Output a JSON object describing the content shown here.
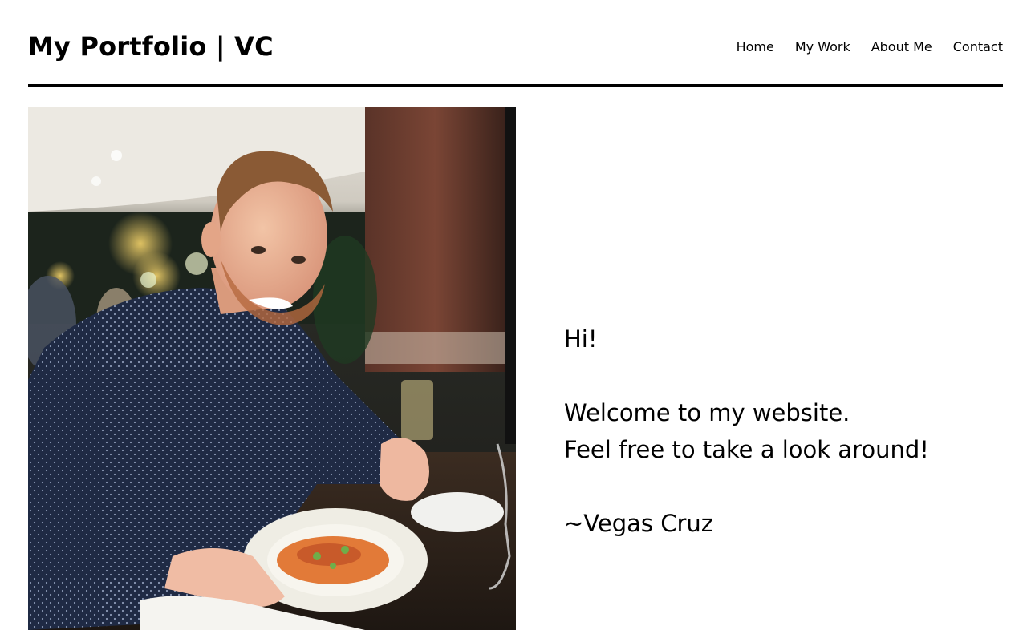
{
  "header": {
    "site_title": "My Portfolio | VC",
    "nav": [
      {
        "label": "Home"
      },
      {
        "label": "My Work"
      },
      {
        "label": "About Me"
      },
      {
        "label": "Contact"
      }
    ]
  },
  "hero": {
    "photo_alt": "Portrait photo of a smiling man at a restaurant table with a plate of pasta",
    "greeting": "Hi!",
    "line1": "Welcome to my website.",
    "line2": "Feel free to take a look around!",
    "signature": "~Vegas Cruz"
  }
}
